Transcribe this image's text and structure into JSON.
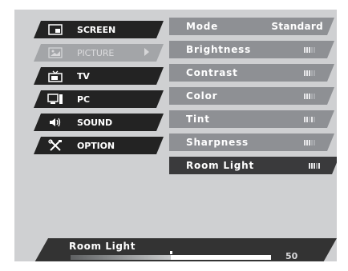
{
  "menu": {
    "items": [
      {
        "label": "SCREEN",
        "icon": "screen-icon"
      },
      {
        "label": "PICTURE",
        "icon": "picture-icon",
        "selected": true
      },
      {
        "label": "TV",
        "icon": "tv-icon"
      },
      {
        "label": "PC",
        "icon": "pc-icon"
      },
      {
        "label": "SOUND",
        "icon": "sound-icon"
      },
      {
        "label": "OPTION",
        "icon": "option-icon"
      }
    ]
  },
  "submenu": {
    "mode": {
      "label": "Mode",
      "value": "Standard"
    },
    "items": [
      {
        "label": "Brightness",
        "level": 0.6
      },
      {
        "label": "Contrast",
        "level": 0.5
      },
      {
        "label": "Color",
        "level": 0.5
      },
      {
        "label": "Tint",
        "level": 0.5
      },
      {
        "label": "Sharpness",
        "level": 0.5
      },
      {
        "label": "Room Light",
        "level": 0.5,
        "active": true
      }
    ]
  },
  "bottom": {
    "title": "Room Light",
    "value": "50",
    "level": 0.5
  },
  "colors": {
    "panel": "#cfd0d2",
    "menu_item": "#232323",
    "menu_selected": "#a3a5a8",
    "sub_item": "#8e9094",
    "sub_active": "#3a3a3c",
    "bottom_bar": "#333333"
  }
}
